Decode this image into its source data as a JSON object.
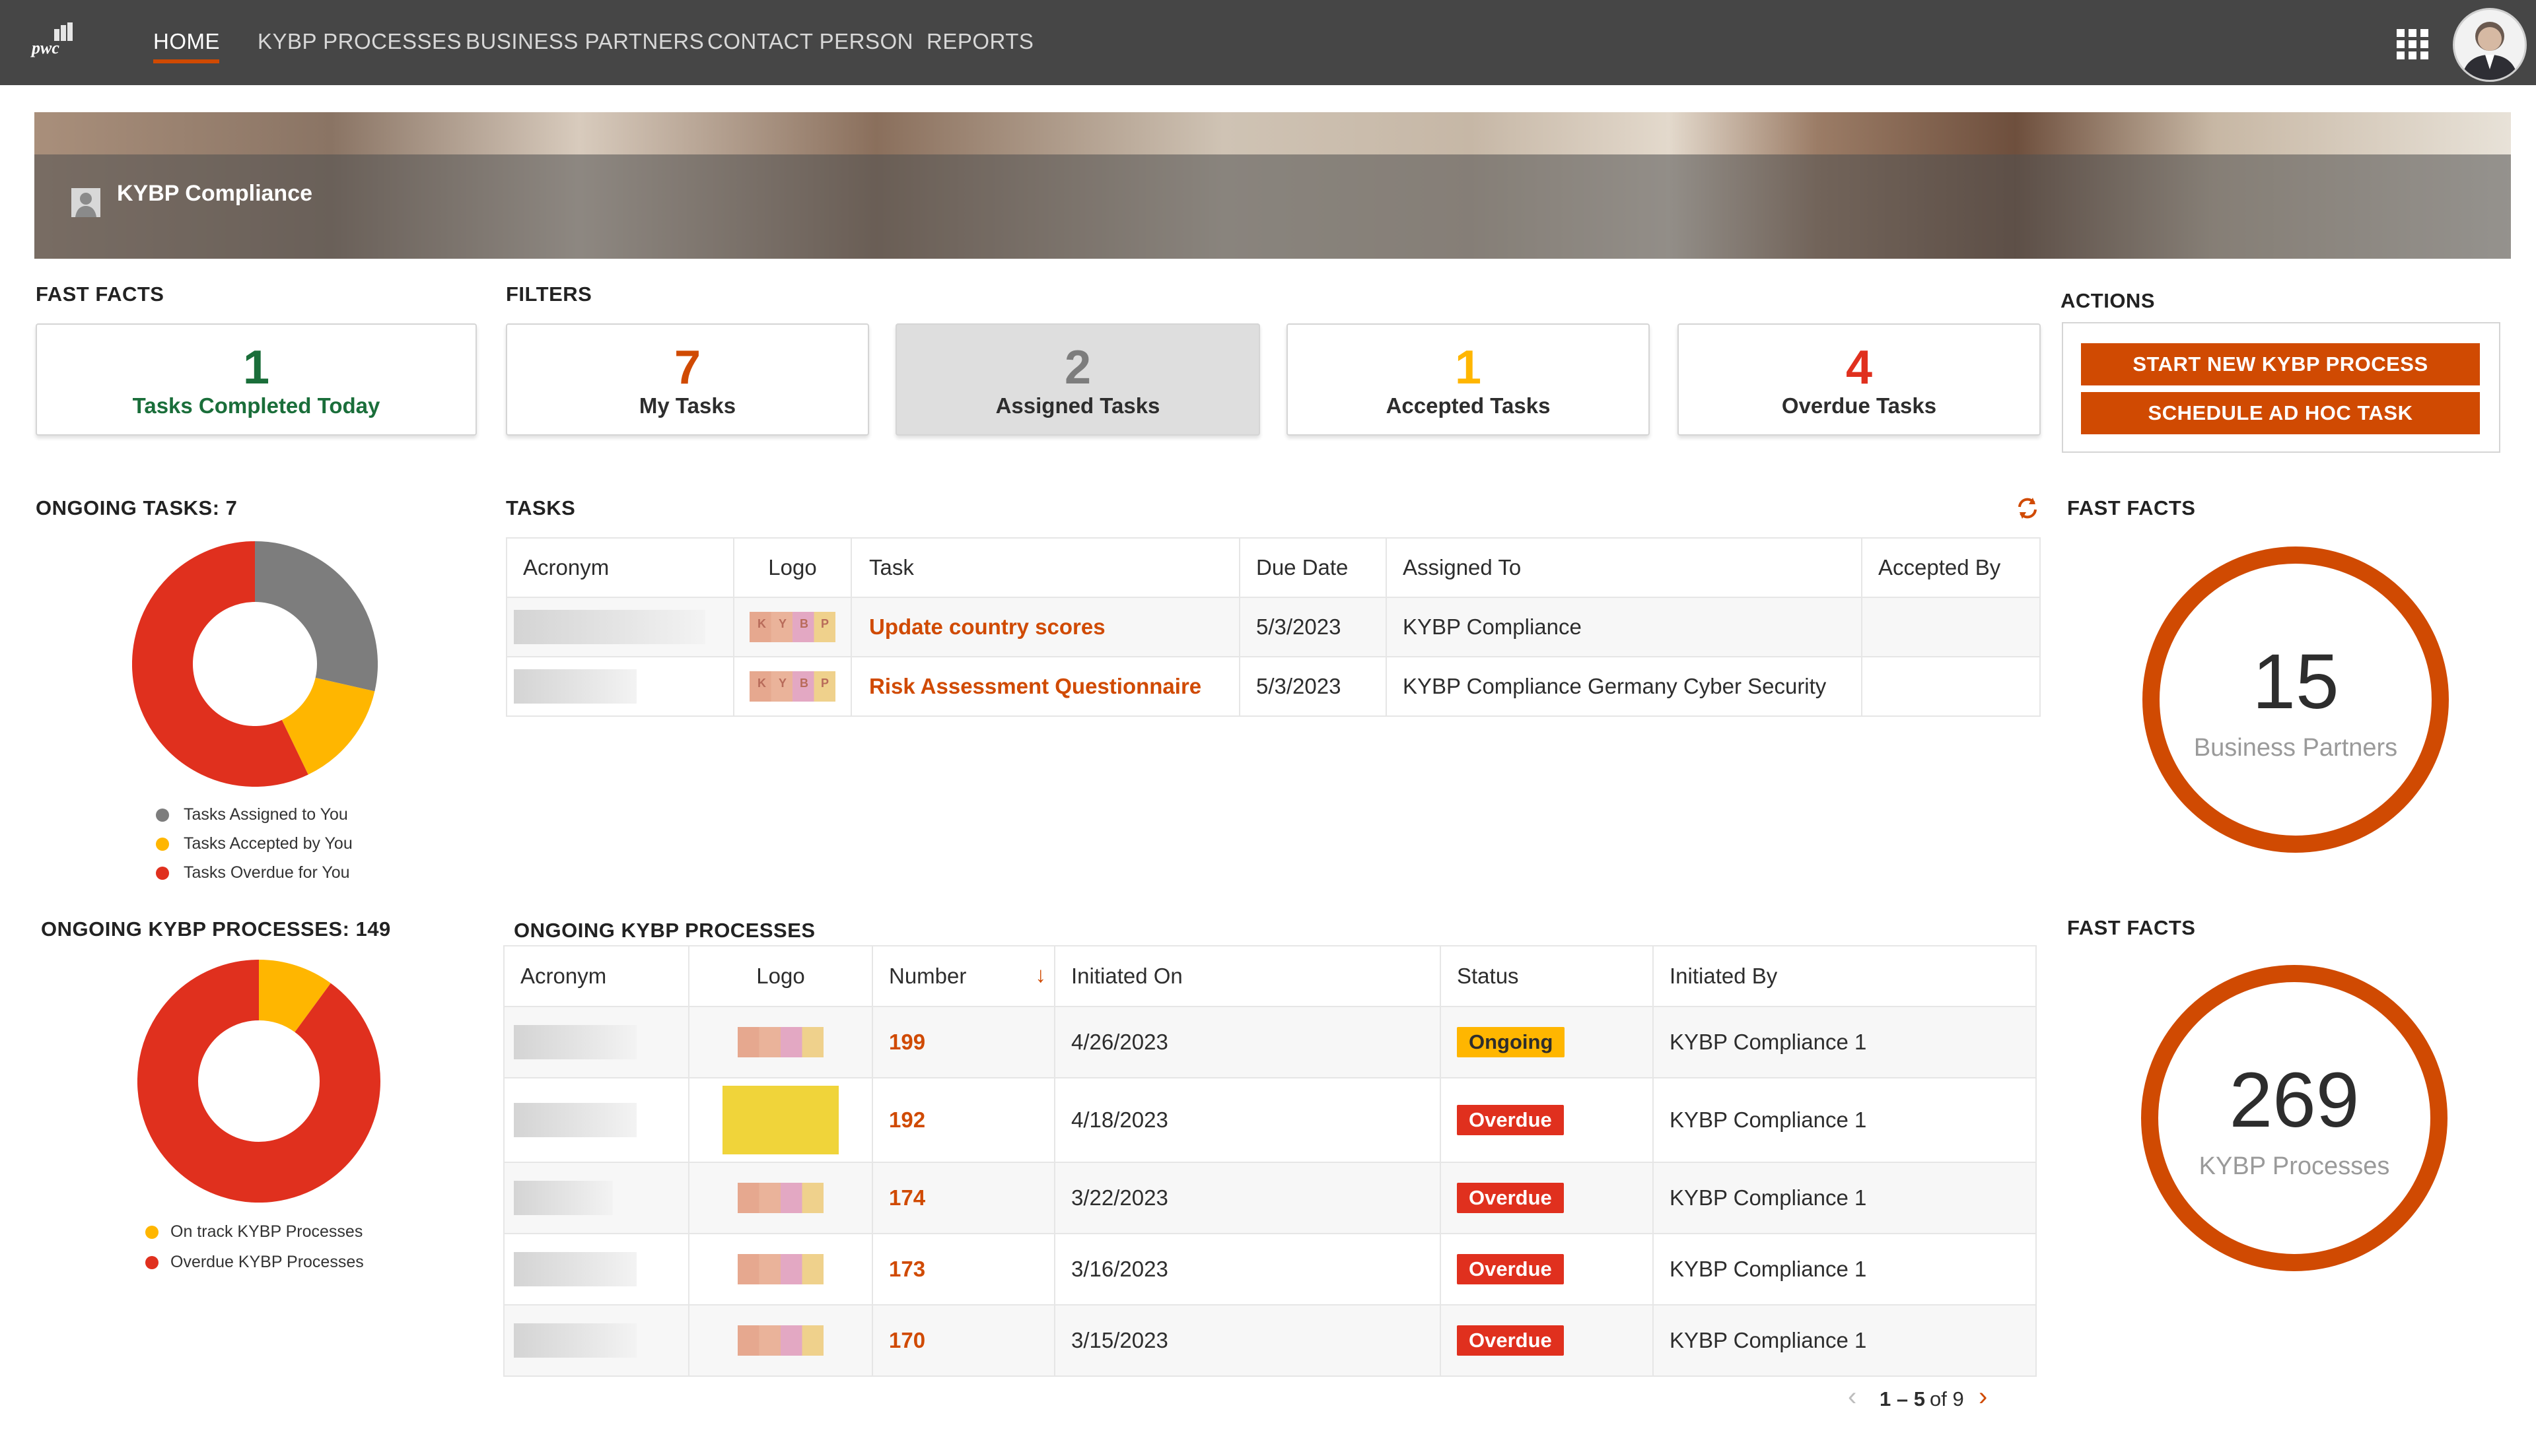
{
  "nav": {
    "brand": "pwc",
    "items": [
      "HOME",
      "KYBP PROCESSES",
      "BUSINESS PARTNERS",
      "CONTACT PERSON",
      "REPORTS"
    ]
  },
  "hero": {
    "title": "KYBP Compliance"
  },
  "sections": {
    "fast_facts": "FAST FACTS",
    "filters": "FILTERS",
    "actions": "ACTIONS",
    "ongoing_tasks": "ONGOING TASKS: 7",
    "tasks": "TASKS",
    "fast_facts_2": "FAST FACTS",
    "ongoing_processes_count": "ONGOING KYBP PROCESSES: 149",
    "ongoing_processes": "ONGOING KYBP PROCESSES",
    "fast_facts_3": "FAST FACTS"
  },
  "cards": {
    "completed": {
      "value": "1",
      "label": "Tasks Completed Today",
      "color": "#1a6e3a"
    },
    "my_tasks": {
      "value": "7",
      "label": "My Tasks",
      "color": "#d04a02"
    },
    "assigned": {
      "value": "2",
      "label": "Assigned Tasks",
      "color": "#7d7d7d"
    },
    "accepted": {
      "value": "1",
      "label": "Accepted Tasks",
      "color": "#ffb600"
    },
    "overdue": {
      "value": "4",
      "label": "Overdue Tasks",
      "color": "#e0301e"
    }
  },
  "actions": {
    "start": "START NEW KYBP PROCESS",
    "schedule": "SCHEDULE AD HOC TASK"
  },
  "tasks_donut": {
    "segments": [
      {
        "name": "Tasks Assigned to You",
        "value": 2,
        "color": "#7d7d7d"
      },
      {
        "name": "Tasks Accepted by You",
        "value": 1,
        "color": "#ffb600"
      },
      {
        "name": "Tasks Overdue for You",
        "value": 4,
        "color": "#e0301e"
      }
    ]
  },
  "process_donut": {
    "segments": [
      {
        "name": "On track KYBP Processes",
        "value": 15,
        "color": "#ffb600"
      },
      {
        "name": "Overdue KYBP Processes",
        "value": 134,
        "color": "#e0301e"
      }
    ]
  },
  "tasks_table": {
    "headers": [
      "Acronym",
      "Logo",
      "Task",
      "Due Date",
      "Assigned To",
      "Accepted By"
    ],
    "rows": [
      {
        "task": "Update country scores",
        "due": "5/3/2023",
        "assigned_to": "KYBP Compliance",
        "accepted_by": ""
      },
      {
        "task": "Risk Assessment Questionnaire",
        "due": "5/3/2023",
        "assigned_to": "KYBP Compliance Germany Cyber Security",
        "accepted_by": ""
      }
    ]
  },
  "process_table": {
    "headers": [
      "Acronym",
      "Logo",
      "Number",
      "Initiated On",
      "Status",
      "Initiated By"
    ],
    "sort_indicator": "↓",
    "rows": [
      {
        "number": "199",
        "initiated_on": "4/26/2023",
        "status": "Ongoing",
        "initiated_by": "KYBP Compliance 1"
      },
      {
        "number": "192",
        "initiated_on": "4/18/2023",
        "status": "Overdue",
        "initiated_by": "KYBP Compliance 1"
      },
      {
        "number": "174",
        "initiated_on": "3/22/2023",
        "status": "Overdue",
        "initiated_by": "KYBP Compliance 1"
      },
      {
        "number": "173",
        "initiated_on": "3/16/2023",
        "status": "Overdue",
        "initiated_by": "KYBP Compliance 1"
      },
      {
        "number": "170",
        "initiated_on": "3/15/2023",
        "status": "Overdue",
        "initiated_by": "KYBP Compliance 1"
      }
    ]
  },
  "pager": {
    "range": "1 – 5",
    "of": "of 9"
  },
  "kpi_partners": {
    "value": "15",
    "label": "Business Partners"
  },
  "kpi_processes": {
    "value": "269",
    "label": "KYBP Processes"
  },
  "colors": {
    "accent": "#d04a02",
    "nav_bg": "#464646"
  }
}
